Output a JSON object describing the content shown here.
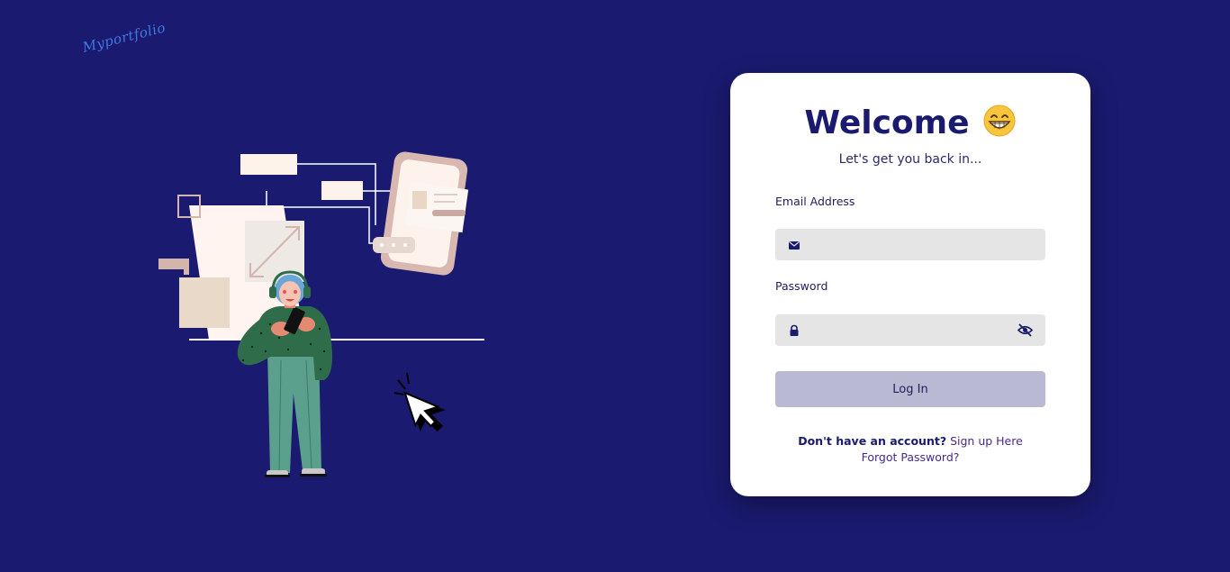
{
  "brand": {
    "logo_text": "Myportfolio"
  },
  "login": {
    "title": "Welcome",
    "title_emoji": "grinning-face-icon",
    "subtitle": "Let's get you back in...",
    "email_label": "Email Address",
    "email_value": "",
    "email_icon": "envelope-icon",
    "password_label": "Password",
    "password_value": "",
    "password_icon": "lock-icon",
    "password_toggle_icon": "eye-slash-icon",
    "login_button": "Log In",
    "signup_prompt": "Don't have an account?",
    "signup_link": "Sign up Here",
    "forgot_link": "Forgot Password?"
  },
  "colors": {
    "background": "#1a1a70",
    "card": "#ffffff",
    "primary_text": "#1a1a6e",
    "input_bg": "#e5e5e5",
    "button_bg": "#b9b9d3",
    "logo": "#3f7ae0"
  }
}
